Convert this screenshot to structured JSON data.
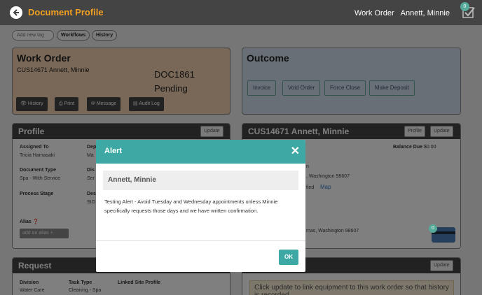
{
  "header": {
    "title": "Document Profile",
    "work_order_label": "Work Order",
    "user_name": "Annett, Minnie",
    "task_count": "0"
  },
  "tags": {
    "placeholder": "Add new tag",
    "workflows": "Workflows",
    "history": "History"
  },
  "work_order": {
    "title": "Work Order",
    "customer": "CUS14671 Annett, Minnie",
    "doc_id": "DOC1861",
    "status": "Pending",
    "buttons": {
      "history": "History",
      "print": "Print",
      "message": "Message",
      "audit": "Audit Log"
    }
  },
  "outcome": {
    "title": "Outcome",
    "buttons": [
      "Invoice",
      "Void Order",
      "Force Close",
      "Make Deposit"
    ]
  },
  "profile": {
    "title": "Profile",
    "update": "Update",
    "assigned_to_label": "Assigned To",
    "assigned_to": "Tricia Hamasaki",
    "dept_label": "Dep",
    "dept_val": "Ma",
    "doc_type_label": "Document Type",
    "doc_type": "Spa - With Service",
    "dist_label": "Dis",
    "dist_val": "Ser",
    "stage_label": "Process Stage",
    "desc_label": "Des",
    "desc_val": "SIO",
    "alias_label": "Alias",
    "alias_placeholder": "add an alias"
  },
  "customer": {
    "title": "CUS14671 Annett, Minnie",
    "profile_btn": "Profile",
    "update_btn": "Update",
    "balance_label": "Balance Due",
    "balance": "$0.00",
    "frag1": "n",
    "addr1": ", Washington 98607",
    "frag2": "fied",
    "map": "Map",
    "addr2": "mas, Washington 98607",
    "card_badge": "0"
  },
  "request": {
    "title": "Request",
    "division_label": "Division",
    "division": "Water Care",
    "task_label": "Task Type",
    "task": "Cleaning - Spa",
    "linked_label": "Linked Site Profile"
  },
  "equipment": {
    "update": "Update",
    "message": "Click update to link equipment to this work order so that history is recorded."
  },
  "alert": {
    "title": "Alert",
    "close": "✕",
    "name": "Annett, Minnie",
    "message": "Testing Alert - Avoid Tuesday and Wednesday appointments unless Minnie specifically requests those days and we have written confirmation.",
    "ok": "OK"
  }
}
